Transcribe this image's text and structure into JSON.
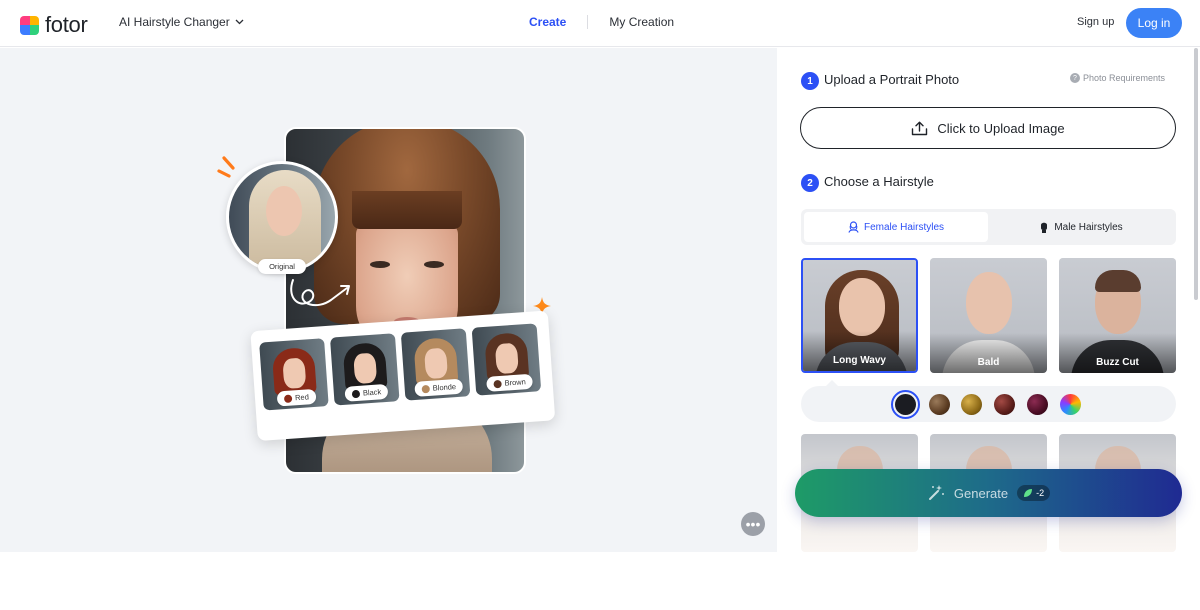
{
  "header": {
    "logo_text": "fotor",
    "tool_name": "AI Hairstyle Changer",
    "nav": {
      "create": "Create",
      "my_creation": "My Creation"
    },
    "signup": "Sign up",
    "login": "Log in",
    "accent": "#2c50f5",
    "login_color": "#3b82f6"
  },
  "preview": {
    "original_label": "Original",
    "color_examples": [
      {
        "label": "Red",
        "color": "#8a2a18"
      },
      {
        "label": "Black",
        "color": "#1d1b1c"
      },
      {
        "label": "Blonde",
        "color": "#b58a5e"
      },
      {
        "label": "Brown",
        "color": "#5a3322"
      }
    ],
    "more_icon": "more-dots-icon"
  },
  "panel": {
    "step1": {
      "number": "1",
      "title": "Upload a Portrait Photo",
      "requirements": "Photo Requirements"
    },
    "upload_button": "Click to Upload Image",
    "step2": {
      "number": "2",
      "title": "Choose a Hairstyle"
    },
    "tabs": [
      {
        "label": "Female Hairstyles",
        "active": true,
        "icon": "female-icon"
      },
      {
        "label": "Male Hairstyles",
        "active": false,
        "icon": "male-icon"
      }
    ],
    "styles": [
      {
        "label": "Long Wavy",
        "selected": true
      },
      {
        "label": "Bald",
        "selected": false
      },
      {
        "label": "Buzz Cut",
        "selected": false
      }
    ],
    "hair_colors": [
      {
        "name": "black",
        "color": "#1b1c22",
        "selected": true
      },
      {
        "name": "brown",
        "color": "#5b3c22"
      },
      {
        "name": "golden",
        "color": "#8e6a17"
      },
      {
        "name": "auburn",
        "color": "#5a1d1a"
      },
      {
        "name": "burgundy",
        "color": "#4a0d24"
      },
      {
        "name": "rainbow",
        "color": "multicolor"
      }
    ],
    "generate": {
      "label": "Generate",
      "credit": "-2",
      "icon": "magic-wand-icon"
    }
  }
}
